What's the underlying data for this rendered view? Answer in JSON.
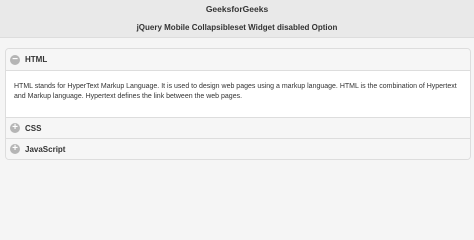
{
  "header": {
    "site_title": "GeeksforGeeks",
    "subtitle": "jQuery Mobile Collapsibleset Widget disabled Option"
  },
  "collapsibleset": {
    "items": [
      {
        "label": "HTML",
        "icon": "minus",
        "icon_glyph": "−",
        "expanded": true,
        "content": "HTML stands for HyperText Markup Language. It is used to design web pages using a markup language. HTML is the combination of Hypertext and Markup language. Hypertext defines the link between the web pages."
      },
      {
        "label": "CSS",
        "icon": "plus",
        "icon_glyph": "+",
        "expanded": false
      },
      {
        "label": "JavaScript",
        "icon": "plus",
        "icon_glyph": "+",
        "expanded": false
      }
    ]
  },
  "colors": {
    "header_bg": "#e9e9e9",
    "page_bg": "#f5f5f5",
    "heading_bg": "#f6f6f6",
    "content_bg": "#ffffff",
    "icon_bg": "#b5b5b5"
  }
}
